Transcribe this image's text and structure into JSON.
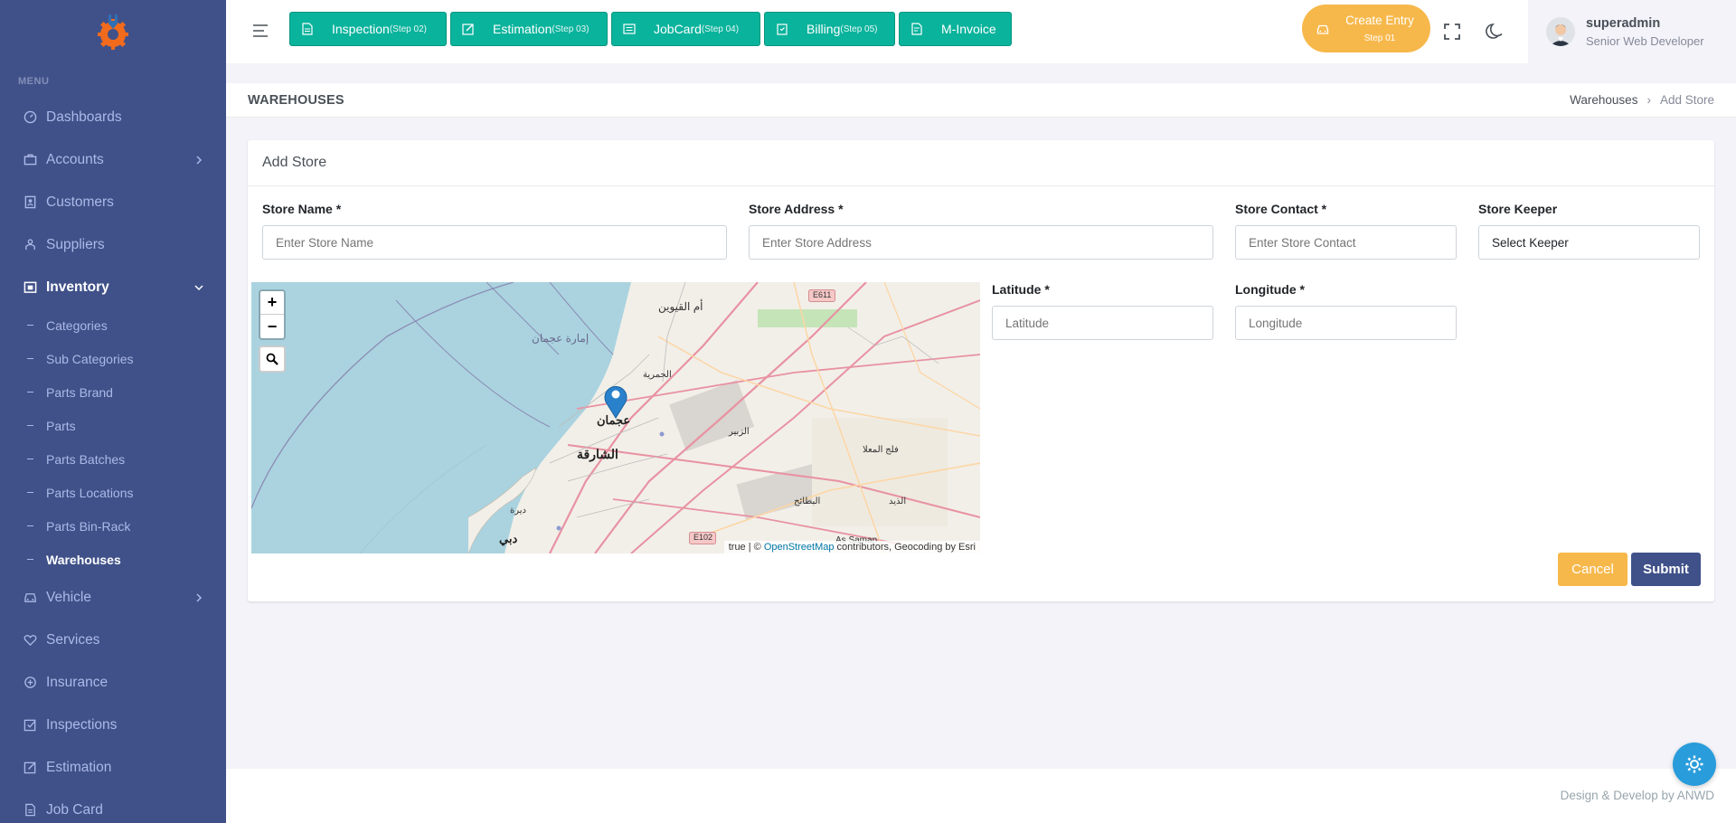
{
  "sidebar": {
    "menu_title": "MENU",
    "items": [
      {
        "label": "Dashboards",
        "icon": "dashboard-icon"
      },
      {
        "label": "Accounts",
        "icon": "briefcase-icon"
      },
      {
        "label": "Customers",
        "icon": "contacts-icon"
      },
      {
        "label": "Suppliers",
        "icon": "team-icon"
      },
      {
        "label": "Inventory",
        "icon": "store-icon"
      },
      {
        "label": "Vehicle",
        "icon": "car-icon"
      },
      {
        "label": "Services",
        "icon": "heart-icon"
      },
      {
        "label": "Insurance",
        "icon": "insurance-icon"
      },
      {
        "label": "Inspections",
        "icon": "checkbox-icon"
      },
      {
        "label": "Estimation",
        "icon": "edit-icon"
      },
      {
        "label": "Job Card",
        "icon": "file-icon"
      }
    ],
    "inventory_sub": [
      "Categories",
      "Sub Categories",
      "Parts Brand",
      "Parts",
      "Parts Batches",
      "Parts Locations",
      "Parts Bin-Rack",
      "Warehouses"
    ]
  },
  "topbar": {
    "steps": [
      {
        "label": "Inspection",
        "step": "(Step 02)"
      },
      {
        "label": "Estimation",
        "step": "(Step 03)"
      },
      {
        "label": "JobCard",
        "step": "(Step 04)"
      },
      {
        "label": "Billing",
        "step": "(Step 05)"
      },
      {
        "label": "M-Invoice",
        "step": ""
      }
    ],
    "create_entry": "Create Entry",
    "create_entry_step": "Step 01",
    "user_name": "superadmin",
    "user_role": "Senior Web Developer"
  },
  "page": {
    "title": "WAREHOUSES",
    "breadcrumb_parent": "Warehouses",
    "breadcrumb_current": "Add Store"
  },
  "form": {
    "card_title": "Add Store",
    "store_name_label": "Store Name *",
    "store_name_placeholder": "Enter Store Name",
    "store_address_label": "Store Address *",
    "store_address_placeholder": "Enter Store Address",
    "store_contact_label": "Store Contact *",
    "store_contact_placeholder": "Enter Store Contact",
    "store_keeper_label": "Store Keeper",
    "store_keeper_value": "Select Keeper",
    "latitude_label": "Latitude *",
    "latitude_placeholder": "Latitude",
    "longitude_label": "Longitude *",
    "longitude_placeholder": "Longitude",
    "cancel_label": "Cancel",
    "submit_label": "Submit"
  },
  "map": {
    "zoom_in": "+",
    "zoom_out": "−",
    "attribution_prefix": "true | © ",
    "attribution_link": "OpenStreetMap",
    "attribution_suffix": " contributors, Geocoding by Esri",
    "place_labels": [
      "أم القيوين",
      "إمارة عجمان",
      "الحمرية",
      "عجمان",
      "الشارقة",
      "الزبير",
      "فلج المعلا",
      "البطائح",
      "الذيد",
      "ديرة",
      "دبي",
      "E611",
      "E102",
      "As Saman"
    ]
  },
  "footer": {
    "text": "Design & Develop by ANWD"
  }
}
